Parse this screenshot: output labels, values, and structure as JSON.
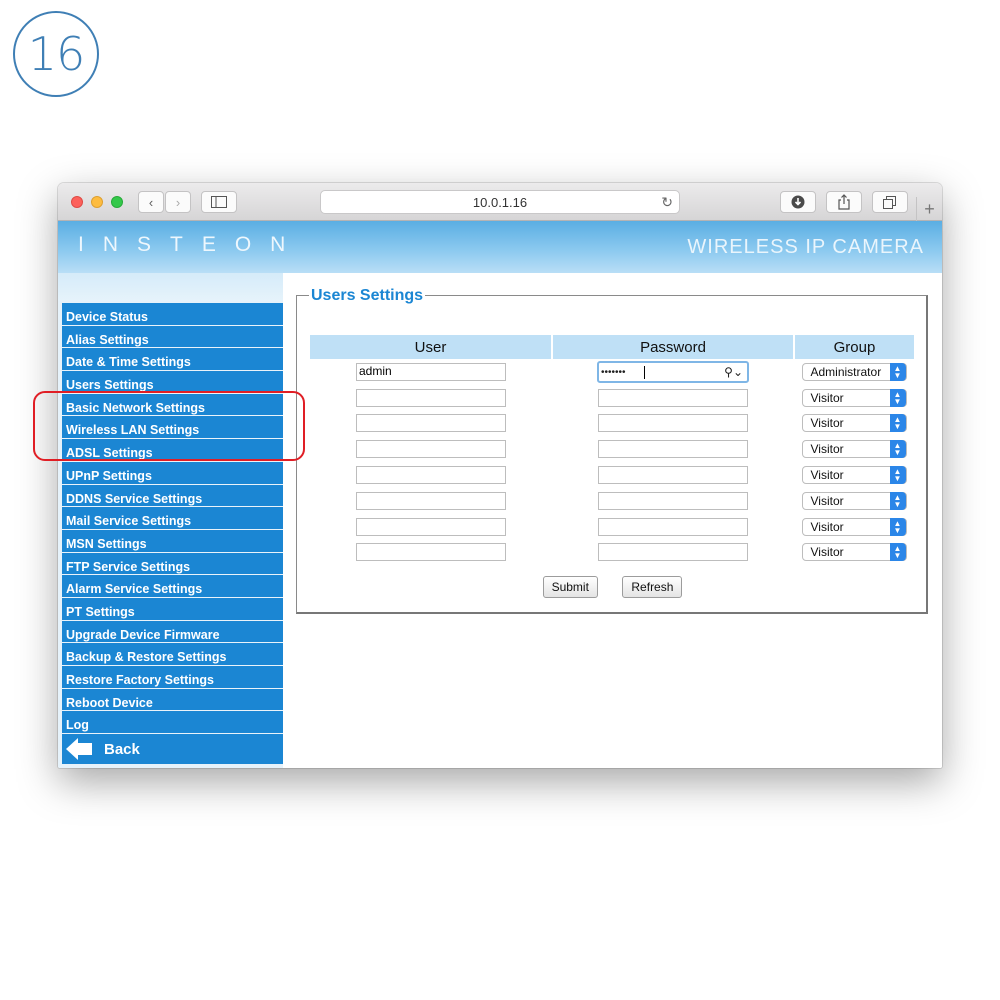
{
  "step_number": "16",
  "browser": {
    "url": "10.0.1.16",
    "icons": [
      "back-chevron",
      "forward-chevron",
      "sidebar",
      "reload",
      "download",
      "share",
      "tabs",
      "plus"
    ]
  },
  "header": {
    "logo": "INSTEON",
    "title": "WIRELESS IP CAMERA"
  },
  "sidebar": {
    "items": [
      {
        "label": "Device Status"
      },
      {
        "label": "Alias Settings"
      },
      {
        "label": "Date & Time Settings"
      },
      {
        "label": "Users Settings"
      },
      {
        "label": "Basic Network Settings"
      },
      {
        "label": "Wireless LAN Settings"
      },
      {
        "label": "ADSL Settings"
      },
      {
        "label": "UPnP Settings"
      },
      {
        "label": "DDNS Service Settings"
      },
      {
        "label": "Mail Service Settings"
      },
      {
        "label": "MSN Settings"
      },
      {
        "label": "FTP Service Settings"
      },
      {
        "label": "Alarm Service Settings"
      },
      {
        "label": "PT Settings"
      },
      {
        "label": "Upgrade Device Firmware"
      },
      {
        "label": "Backup & Restore Settings"
      },
      {
        "label": "Restore Factory Settings"
      },
      {
        "label": "Reboot Device"
      },
      {
        "label": "Log"
      }
    ],
    "back_label": "Back"
  },
  "users_settings": {
    "title": "Users Settings",
    "columns": [
      "User",
      "Password",
      "Group"
    ],
    "rows": [
      {
        "user": "admin",
        "password": "•••••••",
        "group": "Administrator"
      },
      {
        "user": "",
        "password": "",
        "group": "Visitor"
      },
      {
        "user": "",
        "password": "",
        "group": "Visitor"
      },
      {
        "user": "",
        "password": "",
        "group": "Visitor"
      },
      {
        "user": "",
        "password": "",
        "group": "Visitor"
      },
      {
        "user": "",
        "password": "",
        "group": "Visitor"
      },
      {
        "user": "",
        "password": "",
        "group": "Visitor"
      },
      {
        "user": "",
        "password": "",
        "group": "Visitor"
      }
    ],
    "submit_label": "Submit",
    "refresh_label": "Refresh"
  },
  "colors": {
    "menu_blue": "#1b86d3",
    "header_blue": "#5aaee3",
    "highlight_red": "#e01e25",
    "select_blue": "#2b86e8"
  }
}
